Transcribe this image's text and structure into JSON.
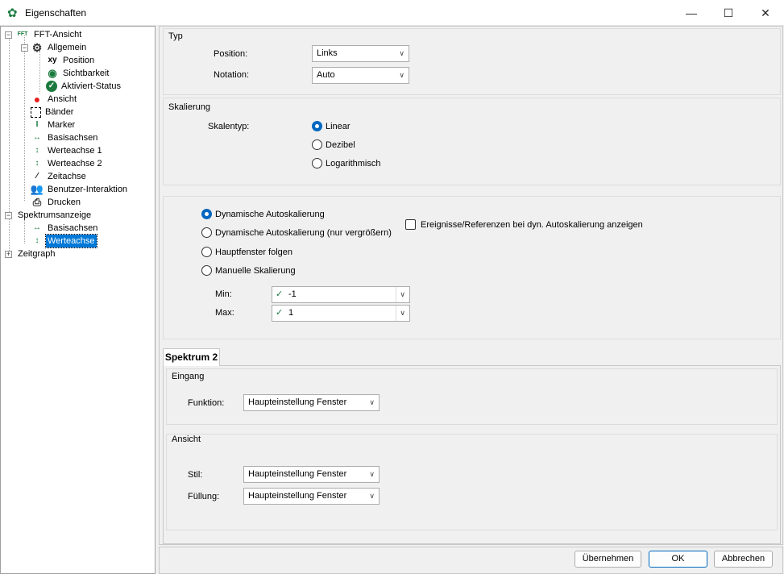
{
  "window": {
    "title": "Eigenschaften",
    "minimize": "—",
    "maximize": "☐",
    "close": "✕"
  },
  "tree": {
    "root": {
      "label": "FFT-Ansicht",
      "icon_text": "FFT"
    },
    "items": [
      {
        "label": "Allgemein",
        "icon": "gear-icon"
      },
      {
        "label": "Position",
        "icon": "xy-icon"
      },
      {
        "label": "Sichtbarkeit",
        "icon": "eye-icon"
      },
      {
        "label": "Aktiviert-Status",
        "icon": "check-circle-icon"
      },
      {
        "label": "Ansicht",
        "icon": "color-dots-icon"
      },
      {
        "label": "Bänder",
        "icon": "bands-icon"
      },
      {
        "label": "Marker",
        "icon": "marker-icon"
      },
      {
        "label": "Basisachsen",
        "icon": "x-axis-icon"
      },
      {
        "label": "Werteachse 1",
        "icon": "y-axis-icon"
      },
      {
        "label": "Werteachse 2",
        "icon": "y-axis-icon"
      },
      {
        "label": "Zeitachse",
        "icon": "z-axis-icon"
      },
      {
        "label": "Benutzer-Interaktion",
        "icon": "users-icon"
      },
      {
        "label": "Drucken",
        "icon": "printer-icon"
      }
    ],
    "spektrum": {
      "label": "Spektrumsanzeige",
      "children": [
        {
          "label": "Basisachsen"
        },
        {
          "label": "Werteachse",
          "selected": true
        }
      ]
    },
    "zeitgraph": {
      "label": "Zeitgraph"
    }
  },
  "typ": {
    "title": "Typ",
    "position_label": "Position:",
    "position_value": "Links",
    "notation_label": "Notation:",
    "notation_value": "Auto"
  },
  "skalierung": {
    "title": "Skalierung",
    "skalentyp_label": "Skalentyp:",
    "options": [
      "Linear",
      "Dezibel",
      "Logarithmisch"
    ],
    "selected": "Linear"
  },
  "auto": {
    "options": [
      "Dynamische Autoskalierung",
      "Dynamische Autoskalierung (nur vergrößern)",
      "Hauptfenster folgen",
      "Manuelle Skalierung"
    ],
    "selected": "Dynamische Autoskalierung",
    "checkbox_label": "Ereignisse/Referenzen bei dyn. Autoskalierung anzeigen",
    "checkbox_checked": false,
    "min_label": "Min:",
    "min_value": "-1",
    "max_label": "Max:",
    "max_value": "1"
  },
  "tab": {
    "label": "Spektrum 2",
    "eingang": {
      "title": "Eingang",
      "funktion_label": "Funktion:",
      "funktion_value": "Haupteinstellung Fenster"
    },
    "ansicht": {
      "title": "Ansicht",
      "stil_label": "Stil:",
      "stil_value": "Haupteinstellung Fenster",
      "fuellung_label": "Füllung:",
      "fuellung_value": "Haupteinstellung Fenster"
    }
  },
  "buttons": {
    "apply": "Übernehmen",
    "ok": "OK",
    "cancel": "Abbrechen"
  },
  "colors": {
    "accent": "#0078d7",
    "icon_green": "#1b7a3e"
  }
}
